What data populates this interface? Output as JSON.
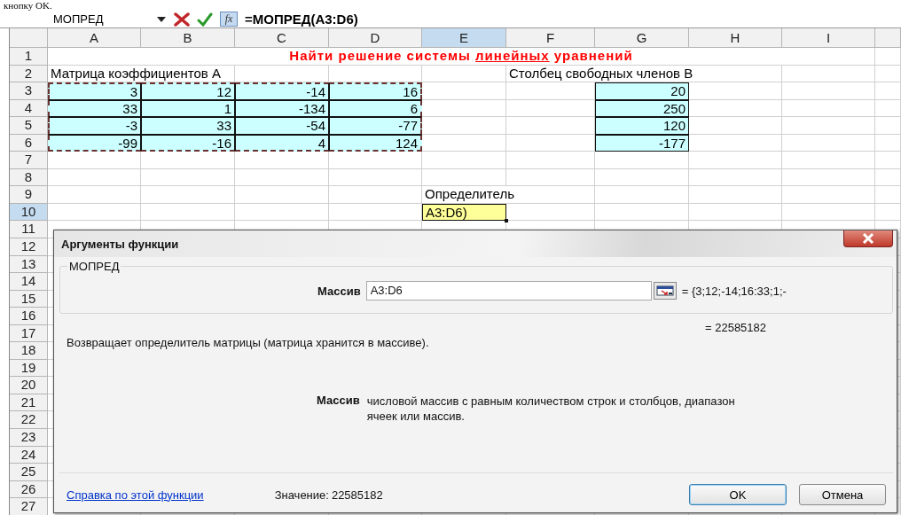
{
  "document_text": "кнопку OK.",
  "formula_bar": {
    "name_box": "МОПРЕД",
    "function_button": "fx",
    "formula": "=МОПРЕД(A3:D6)"
  },
  "sheet": {
    "columns": [
      {
        "label": "A",
        "selected": false
      },
      {
        "label": "B",
        "selected": false
      },
      {
        "label": "C",
        "selected": false
      },
      {
        "label": "D",
        "selected": false
      },
      {
        "label": "E",
        "selected": true
      },
      {
        "label": "F",
        "selected": false
      },
      {
        "label": "G",
        "selected": false
      },
      {
        "label": "H",
        "selected": false
      },
      {
        "label": "I",
        "selected": false
      }
    ],
    "rows": [
      {
        "number": "1",
        "selected": false,
        "title": [
          {
            "text": "Найти решение системы ",
            "underline": false
          },
          {
            "text": "линейных",
            "underline": true
          },
          {
            "text": " уравнений",
            "underline": false
          }
        ]
      },
      {
        "number": "2",
        "selected": false,
        "cells": [
          {
            "kind": "text",
            "text": "Матрица коэффициентов А"
          },
          null,
          null,
          null,
          null,
          {
            "kind": "text",
            "text": "Столбец свободных членов В"
          },
          null,
          null,
          null
        ]
      },
      {
        "number": "3",
        "selected": false,
        "cells": [
          {
            "kind": "number",
            "text": "3",
            "in_marquee": true
          },
          {
            "kind": "number",
            "text": "12",
            "in_marquee": true
          },
          {
            "kind": "number",
            "text": "-14",
            "in_marquee": true
          },
          {
            "kind": "number",
            "text": "16",
            "in_marquee": true
          },
          null,
          null,
          {
            "kind": "number",
            "text": "20",
            "in_marquee": false
          },
          null,
          null
        ]
      },
      {
        "number": "4",
        "selected": false,
        "cells": [
          {
            "kind": "number",
            "text": "33",
            "in_marquee": true
          },
          {
            "kind": "number",
            "text": "1",
            "in_marquee": true
          },
          {
            "kind": "number",
            "text": "-134",
            "in_marquee": true
          },
          {
            "kind": "number",
            "text": "6",
            "in_marquee": true
          },
          null,
          null,
          {
            "kind": "number",
            "text": "250",
            "in_marquee": false
          },
          null,
          null
        ]
      },
      {
        "number": "5",
        "selected": false,
        "cells": [
          {
            "kind": "number",
            "text": "-3",
            "in_marquee": true
          },
          {
            "kind": "number",
            "text": "33",
            "in_marquee": true
          },
          {
            "kind": "number",
            "text": "-54",
            "in_marquee": true
          },
          {
            "kind": "number",
            "text": "-77",
            "in_marquee": true
          },
          null,
          null,
          {
            "kind": "number",
            "text": "120",
            "in_marquee": false
          },
          null,
          null
        ]
      },
      {
        "number": "6",
        "selected": false,
        "cells": [
          {
            "kind": "number",
            "text": "-99",
            "in_marquee": true
          },
          {
            "kind": "number",
            "text": "-16",
            "in_marquee": true
          },
          {
            "kind": "number",
            "text": "4",
            "in_marquee": true
          },
          {
            "kind": "number",
            "text": "124",
            "in_marquee": true
          },
          null,
          null,
          {
            "kind": "number",
            "text": "-177",
            "in_marquee": false
          },
          null,
          null
        ]
      },
      {
        "number": "7",
        "selected": false
      },
      {
        "number": "8",
        "selected": false
      },
      {
        "number": "9",
        "selected": false,
        "cells": [
          null,
          null,
          null,
          null,
          {
            "kind": "text",
            "text": "Определитель"
          },
          null,
          null,
          null,
          null
        ]
      },
      {
        "number": "10",
        "selected": true,
        "cells": [
          null,
          null,
          null,
          null,
          {
            "kind": "input",
            "text": "A3:D6)"
          },
          null,
          null,
          null,
          null
        ]
      },
      {
        "number": "11",
        "selected": false
      },
      {
        "number": "12",
        "selected": false
      },
      {
        "number": "13",
        "selected": false
      },
      {
        "number": "14",
        "selected": false
      },
      {
        "number": "15",
        "selected": false
      },
      {
        "number": "16",
        "selected": false
      },
      {
        "number": "17",
        "selected": false
      },
      {
        "number": "18",
        "selected": false
      },
      {
        "number": "19",
        "selected": false
      },
      {
        "number": "20",
        "selected": false
      },
      {
        "number": "21",
        "selected": false
      },
      {
        "number": "22",
        "selected": false
      },
      {
        "number": "23",
        "selected": false
      },
      {
        "number": "24",
        "selected": false
      },
      {
        "number": "25",
        "selected": false
      },
      {
        "number": "26",
        "selected": false
      },
      {
        "number": "27",
        "selected": false
      }
    ]
  },
  "dialog": {
    "title": "Аргументы функции",
    "function_name": "МОПРЕД",
    "argument": {
      "label": "Массив",
      "value": "A3:D6",
      "preview": "= {3;12;-14;16:33;1;-"
    },
    "result": "= 22585182",
    "description": "Возвращает определитель матрицы (матрица хранится в массиве).",
    "argument_help": {
      "label": "Массив",
      "text": "числовой массив с равным количеством строк и столбцов, диапазон ячеек или массив."
    },
    "help_link": "Справка по этой функции",
    "value_label": "Значение:",
    "value": "22585182",
    "buttons": [
      {
        "label": "OK",
        "default": true
      },
      {
        "label": "Отмена",
        "default": false
      }
    ]
  }
}
